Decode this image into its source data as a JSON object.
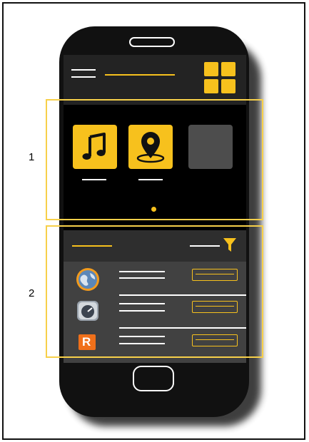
{
  "callouts": [
    {
      "label": "1"
    },
    {
      "label": "2"
    }
  ],
  "colors": {
    "accent": "#f7c11d",
    "phone_body": "#111111",
    "header_bg": "#232323",
    "list_bg": "#414141",
    "callout_border": "#f7d04a"
  },
  "header": {
    "menu_icon": "hamburger-icon",
    "view_icon": "grid-icon"
  },
  "carousel": {
    "tiles": [
      {
        "icon": "music-note-icon",
        "color": "#f7c11d"
      },
      {
        "icon": "location-pin-icon",
        "color": "#f7c11d"
      },
      {
        "icon": "blank-tile",
        "color": "#4d4d4d"
      }
    ]
  },
  "list": {
    "filter_icon": "filter-icon",
    "items": [
      {
        "icon": "globe-app-icon"
      },
      {
        "icon": "gauge-app-icon"
      },
      {
        "icon": "r-logo-app-icon",
        "letter": "R"
      }
    ]
  }
}
